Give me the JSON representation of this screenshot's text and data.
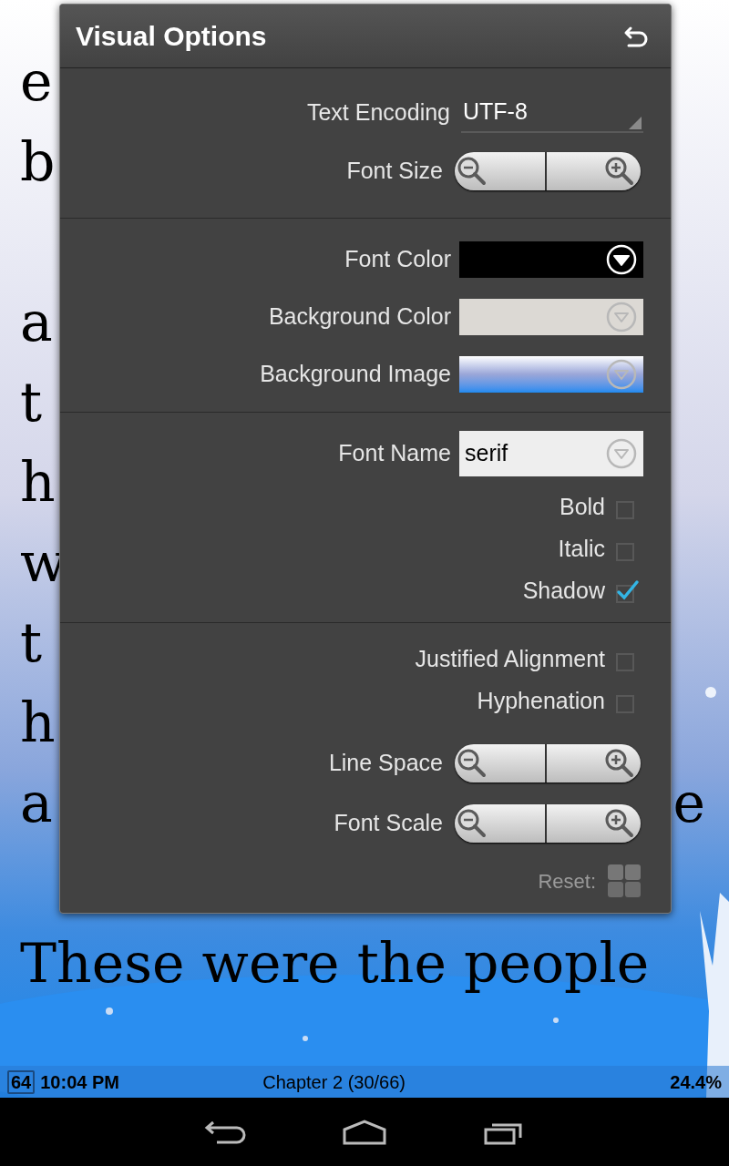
{
  "book": {
    "paragraphs": [
      {
        "lines": [
          {
            "left": "e"
          },
          {
            "left": "b"
          }
        ]
      },
      {
        "lines": [
          {
            "left": "a"
          },
          {
            "left": "t"
          },
          {
            "left": "h"
          },
          {
            "left": "w"
          },
          {
            "left": "t"
          },
          {
            "left": "h"
          },
          {
            "left": "a",
            "right": "e"
          }
        ]
      },
      {
        "lines": [
          {
            "left": "These were the people"
          }
        ]
      }
    ]
  },
  "dialog": {
    "title": "Visual Options",
    "sections": [
      {
        "rows": [
          {
            "kind": "dropdown",
            "label": "Text Encoding",
            "value": "UTF-8"
          },
          {
            "kind": "stepper",
            "label": "Font Size"
          }
        ]
      },
      {
        "rows": [
          {
            "kind": "color",
            "label": "Font Color",
            "color": "#000000"
          },
          {
            "kind": "color",
            "label": "Background Color",
            "color": "#dcd9d4"
          },
          {
            "label": "Background Image"
          }
        ]
      },
      {
        "rows": [
          {
            "kind": "select",
            "label": "Font Name",
            "value": "serif"
          },
          {
            "kind": "checkbox",
            "label": "Bold",
            "checked": false
          },
          {
            "kind": "checkbox",
            "label": "Italic",
            "checked": false
          },
          {
            "kind": "checkbox",
            "label": "Shadow",
            "checked": true
          }
        ]
      },
      {
        "rows": [
          {
            "kind": "checkbox",
            "label": "Justified Alignment",
            "checked": false
          },
          {
            "kind": "checkbox",
            "label": "Hyphenation",
            "checked": false
          },
          {
            "kind": "stepper",
            "label": "Line Space"
          },
          {
            "kind": "stepper",
            "label": "Font Scale"
          },
          {
            "kind": "reset",
            "label": "Reset:"
          }
        ]
      }
    ]
  },
  "status_bar": {
    "battery": "64",
    "time": "10:04 PM",
    "chapter": "Chapter 2 (30/66)",
    "progress": "24.4%"
  }
}
